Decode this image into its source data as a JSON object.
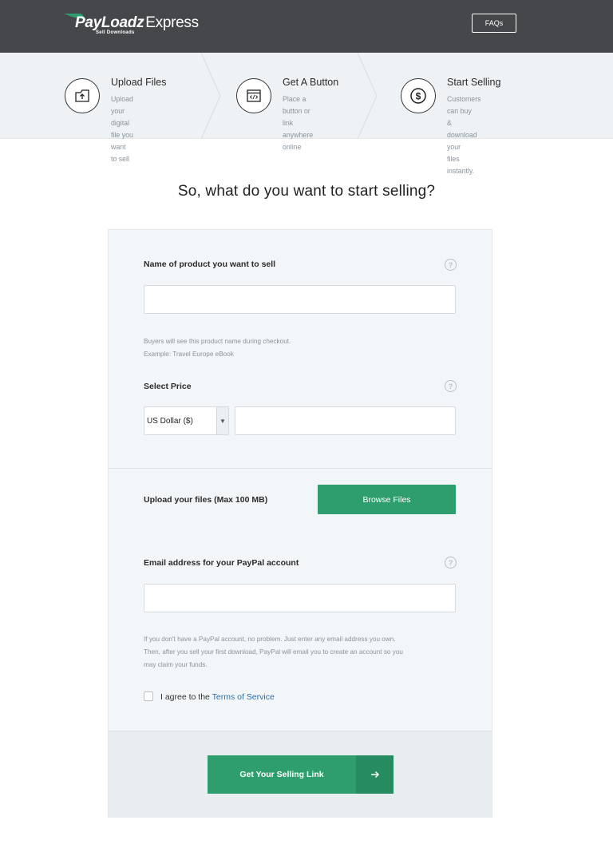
{
  "header": {
    "logo_brand": "PayLoadz",
    "logo_product": "Express",
    "logo_tagline": "Sell Downloads",
    "faq_label": "FAQs",
    "background": "#45474b"
  },
  "steps": [
    {
      "icon": "upload-icon",
      "title": "Upload Files",
      "desc_line1": "Upload your digital file you",
      "desc_line2": "want to sell"
    },
    {
      "icon": "code-window-icon",
      "title": "Get A Button",
      "desc_line1": "Place a button or link",
      "desc_line2": "anywhere online"
    },
    {
      "icon": "dollar-icon",
      "title": "Start Selling",
      "desc_line1": "Customers can buy",
      "desc_line2": "& download your",
      "desc_line3": "files instantly."
    }
  ],
  "headline": "So, what do you want to start selling?",
  "form": {
    "product_label": "Name of product you want to sell",
    "product_value": "",
    "product_note_line1": "Buyers will see this product name during checkout.",
    "product_note_line2": "Example: Travel Europe eBook",
    "price_label": "Select Price",
    "currency_selected": "US Dollar ($)",
    "price_value": "",
    "upload_label": "Upload your files (Max 100 MB)",
    "browse_label": "Browse Files",
    "email_label": "Email address for your PayPal account",
    "email_value": "",
    "email_note_line1": "If you don't have a PayPal account, no problem. Just enter any email address you own.",
    "email_note_line2": "Then, after you sell your first download, PayPal will email you to create an account so you",
    "email_note_line3": "may claim your funds.",
    "agree_prefix": "I agree to the",
    "tos_link": "Terms of Service",
    "agree_checked": false,
    "submit_label": "Get Your Selling Link",
    "help_glyph": "?"
  },
  "colors": {
    "accent_green": "#2e9e6f",
    "link_blue": "#2c6fa8"
  }
}
